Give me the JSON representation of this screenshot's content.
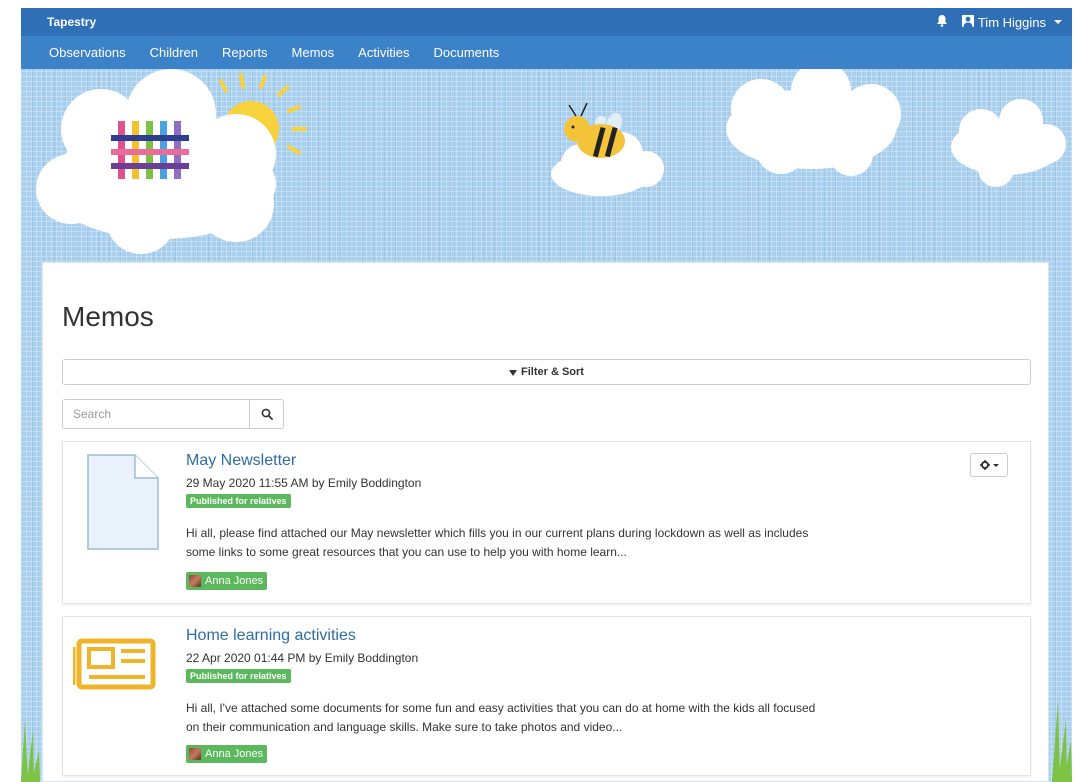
{
  "app": {
    "brand": "Tapestry",
    "user_name": "Tim Higgins"
  },
  "nav": {
    "items": [
      "Observations",
      "Children",
      "Reports",
      "Memos",
      "Activities",
      "Documents"
    ]
  },
  "page": {
    "title": "Memos",
    "filter_label": "Filter & Sort",
    "search_placeholder": "Search"
  },
  "memos": [
    {
      "title": "May Newsletter",
      "meta": "29 May 2020 11:55 AM by Emily Boddington",
      "badge": "Published for relatives",
      "text": "Hi all, please find attached our May newsletter which fills you in our current plans during lockdown as well as includes some links to some great resources that you can use to help you with home learn...",
      "child": "Anna Jones",
      "thumb_icon": "document-icon"
    },
    {
      "title": "Home learning activities",
      "meta": "22 Apr 2020 01:44 PM by Emily Boddington",
      "badge": "Published for relatives",
      "text": "Hi all, I've attached some documents for some fun and easy activities that you can do at home with the kids all focused on their communication and language skills. Make sure to take photos and video...",
      "child": "Anna Jones",
      "thumb_icon": "newspaper-icon"
    }
  ],
  "colors": {
    "topbar": "#2f6fb6",
    "navbar": "#3b82c9",
    "link": "#2e6da4",
    "badge": "#5cb85c",
    "sky": "#a8cfee"
  }
}
